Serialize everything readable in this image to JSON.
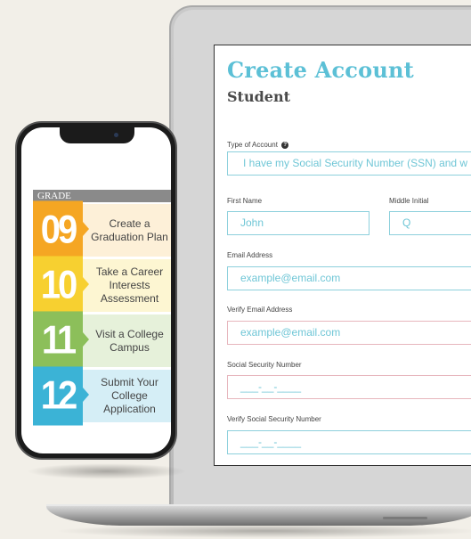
{
  "form": {
    "title": "Create Account",
    "subtitle": "Student",
    "account_type_label": "Type of Account",
    "account_type_value": "I have my Social Security Number (SSN) and w",
    "first_name_label": "First Name",
    "first_name_placeholder": "John",
    "middle_initial_label": "Middle Initial",
    "middle_initial_placeholder": "Q",
    "email_label": "Email Address",
    "email_placeholder": "example@email.com",
    "verify_email_label": "Verify Email Address",
    "verify_email_placeholder": "example@email.com",
    "ssn_label": "Social Security Number",
    "ssn_placeholder": "___-__-____",
    "verify_ssn_label": "Verify Social Security Number",
    "verify_ssn_placeholder": "___-__-____",
    "colors": {
      "accent": "#5cc0d6",
      "field_border": "#8dd0dc",
      "error_border": "#e7b6bd"
    }
  },
  "phone": {
    "grade_header": "GRADE",
    "rows": [
      {
        "grade": "09",
        "text": "Create a Graduation Plan",
        "color": "#f5a623",
        "bg": "#fdf0d8"
      },
      {
        "grade": "10",
        "text": "Take a Career Interests Assessment",
        "color": "#f7d030",
        "bg": "#fdf6d2"
      },
      {
        "grade": "11",
        "text": "Visit a College Campus",
        "color": "#8cbf5a",
        "bg": "#e6f1da"
      },
      {
        "grade": "12",
        "text": "Submit Your College Application",
        "color": "#3bb3d6",
        "bg": "#d5eef6"
      }
    ]
  },
  "icons": {
    "info": "info-circle-icon"
  }
}
